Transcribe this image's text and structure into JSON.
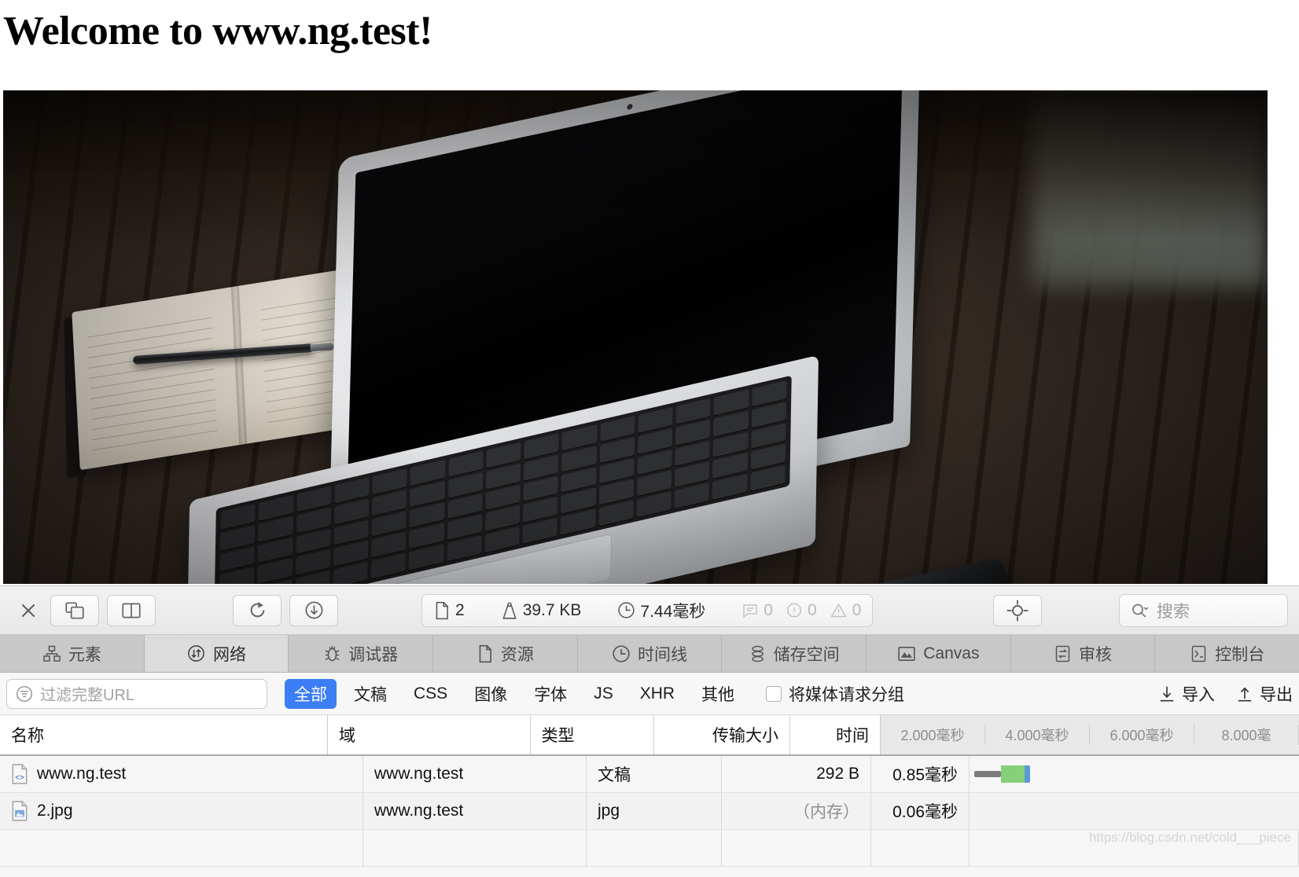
{
  "page": {
    "heading": "Welcome to www.ng.test!",
    "hero_alt": "macbook-air-on-wooden-desk-with-notebook-pen-and-phone"
  },
  "devtools": {
    "toolbar": {
      "close_label": "✕",
      "dock_icon": "dock-window-icon",
      "split_icon": "split-panel-icon",
      "reload_icon": "reload-icon",
      "download_icon": "download-circle-icon",
      "inspect_icon": "crosshair-inspect-icon",
      "stats": [
        {
          "icon": "document-icon",
          "value": "2",
          "dim": false
        },
        {
          "icon": "weight-icon",
          "value": "39.7 KB",
          "dim": false
        },
        {
          "icon": "clock-icon",
          "value": "7.44毫秒",
          "dim": false
        },
        {
          "icon": "message-icon",
          "value": "0",
          "dim": true
        },
        {
          "icon": "error-icon",
          "value": "0",
          "dim": true
        },
        {
          "icon": "warning-icon",
          "value": "0",
          "dim": true
        }
      ],
      "search_placeholder": "搜索"
    },
    "tabs": [
      {
        "label": "元素",
        "icon": "elements-icon",
        "active": false
      },
      {
        "label": "网络",
        "icon": "network-icon",
        "active": true
      },
      {
        "label": "调试器",
        "icon": "debugger-bug-icon",
        "active": false
      },
      {
        "label": "资源",
        "icon": "resources-doc-icon",
        "active": false
      },
      {
        "label": "时间线",
        "icon": "timeline-clock-icon",
        "active": false
      },
      {
        "label": "储存空间",
        "icon": "storage-db-icon",
        "active": false
      },
      {
        "label": "Canvas",
        "icon": "canvas-image-icon",
        "active": false
      },
      {
        "label": "审核",
        "icon": "audit-icon",
        "active": false
      },
      {
        "label": "控制台",
        "icon": "console-icon",
        "active": false
      }
    ],
    "filter": {
      "input_placeholder": "过滤完整URL",
      "filter_icon": "funnel-icon",
      "pills": [
        {
          "label": "全部",
          "active": true
        },
        {
          "label": "文稿",
          "active": false
        },
        {
          "label": "CSS",
          "active": false
        },
        {
          "label": "图像",
          "active": false
        },
        {
          "label": "字体",
          "active": false
        },
        {
          "label": "JS",
          "active": false
        },
        {
          "label": "XHR",
          "active": false
        },
        {
          "label": "其他",
          "active": false
        }
      ],
      "group_media_label": "将媒体请求分组",
      "group_media_checked": false,
      "import_label": "导入",
      "export_label": "导出"
    },
    "table": {
      "columns": [
        "名称",
        "域",
        "类型",
        "传输大小",
        "时间"
      ],
      "waterfall_ticks": [
        "2.000毫秒",
        "4.000毫秒",
        "6.000毫秒",
        "8.000毫"
      ],
      "rows": [
        {
          "icon": "html-document-icon",
          "name": "www.ng.test",
          "domain": "www.ng.test",
          "type": "文稿",
          "size": "292 B",
          "size_memory": false,
          "time": "0.85毫秒",
          "waterfall": {
            "gray": 34,
            "green": 30,
            "blue": 7,
            "offset": 6
          }
        },
        {
          "icon": "image-document-icon",
          "name": "2.jpg",
          "domain": "www.ng.test",
          "type": "jpg",
          "size": "（内存）",
          "size_memory": true,
          "time": "0.06毫秒",
          "waterfall": null
        }
      ]
    },
    "watermark": "https://blog.csdn.net/cold___piece"
  },
  "colors": {
    "accent_blue": "#3b7ef6",
    "waterfall_green": "#86d07a",
    "waterfall_blue": "#5b9bd5",
    "waterfall_gray": "#7b7b7b"
  }
}
